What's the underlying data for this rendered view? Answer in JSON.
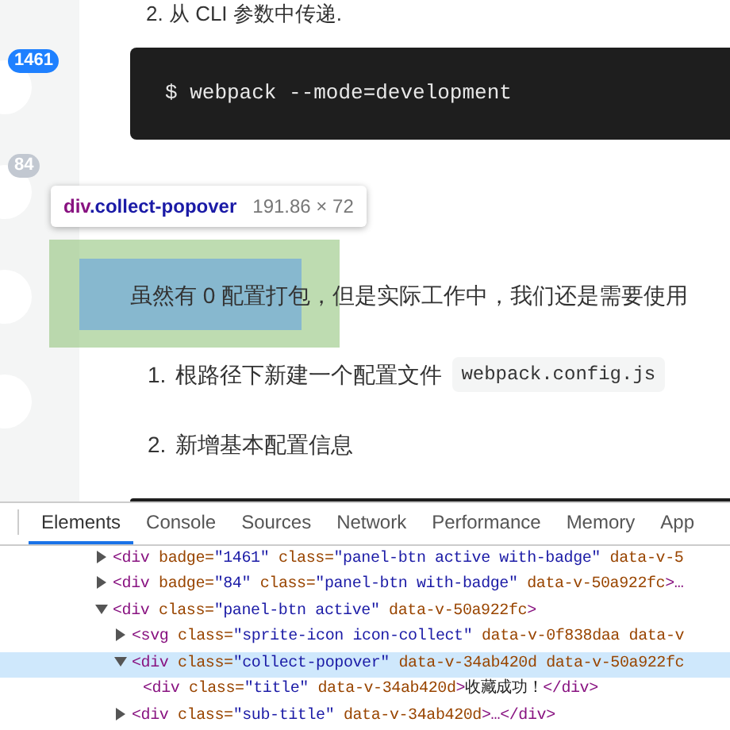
{
  "sidebar": {
    "badges": [
      {
        "text": "1461",
        "highlighted": true
      },
      {
        "text": "84",
        "highlighted": false
      }
    ]
  },
  "article": {
    "step_heading": "2.  从 CLI 参数中传递.",
    "command": "$ webpack --mode=development",
    "paragraph": "虽然有 0 配置打包，但是实际工作中，我们还是需要使用",
    "steps": [
      {
        "number": "1.",
        "text": "根路径下新建一个配置文件",
        "code": "webpack.config.js"
      },
      {
        "number": "2.",
        "text": "新增基本配置信息"
      }
    ]
  },
  "inspect_tooltip": {
    "tag": "div",
    "selector": ".collect-popover",
    "size": "191.86 × 72"
  },
  "devtools": {
    "tabs": [
      {
        "label": "Elements",
        "selected": true
      },
      {
        "label": "Console",
        "selected": false
      },
      {
        "label": "Sources",
        "selected": false
      },
      {
        "label": "Network",
        "selected": false
      },
      {
        "label": "Performance",
        "selected": false
      },
      {
        "label": "Memory",
        "selected": false
      },
      {
        "label": "App",
        "selected": false
      }
    ],
    "lines": [
      {
        "kind": "node",
        "expanded": false,
        "selected": false,
        "children": [
          {
            "kind": "tag",
            "text": "<div "
          },
          {
            "kind": "attr",
            "text": "badge="
          },
          {
            "kind": "value",
            "text": "\"1461\" "
          },
          {
            "kind": "attr",
            "text": "class="
          },
          {
            "kind": "value",
            "text": "\"panel-btn active with-badge\" "
          },
          {
            "kind": "attr",
            "text": "data-v-5"
          }
        ]
      },
      {
        "kind": "node",
        "expanded": false,
        "selected": false,
        "children": [
          {
            "kind": "tag",
            "text": "<div "
          },
          {
            "kind": "attr",
            "text": "badge="
          },
          {
            "kind": "value",
            "text": "\"84\" "
          },
          {
            "kind": "attr",
            "text": "class="
          },
          {
            "kind": "value",
            "text": "\"panel-btn with-badge\" "
          },
          {
            "kind": "attr",
            "text": "data-v-50a922fc"
          },
          {
            "kind": "tag",
            "text": ">…"
          }
        ]
      },
      {
        "kind": "node",
        "expanded": true,
        "selected": false,
        "children": [
          {
            "kind": "tag",
            "text": "<div "
          },
          {
            "kind": "attr",
            "text": "class="
          },
          {
            "kind": "value",
            "text": "\"panel-btn active\" "
          },
          {
            "kind": "attr",
            "text": "data-v-50a922fc"
          },
          {
            "kind": "tag",
            "text": ">"
          }
        ]
      },
      {
        "kind": "child",
        "expanded": false,
        "selected": false,
        "children": [
          {
            "kind": "tag",
            "text": "<svg "
          },
          {
            "kind": "attr",
            "text": "class="
          },
          {
            "kind": "value",
            "text": "\"sprite-icon icon-collect\" "
          },
          {
            "kind": "attr",
            "text": "data-v-0f838daa data-v"
          }
        ]
      },
      {
        "kind": "child",
        "expanded": true,
        "selected": true,
        "children": [
          {
            "kind": "tag",
            "text": "<div "
          },
          {
            "kind": "attr",
            "text": "class="
          },
          {
            "kind": "value",
            "text": "\"collect-popover\" "
          },
          {
            "kind": "attr",
            "text": "data-v-34ab420d data-v-50a922fc"
          }
        ]
      },
      {
        "kind": "leaf",
        "selected": false,
        "children": [
          {
            "kind": "tag",
            "text": "<div "
          },
          {
            "kind": "attr",
            "text": "class="
          },
          {
            "kind": "value",
            "text": "\"title\" "
          },
          {
            "kind": "attr",
            "text": "data-v-34ab420d"
          },
          {
            "kind": "tag",
            "text": ">"
          },
          {
            "kind": "text",
            "text": "收藏成功！"
          },
          {
            "kind": "tag",
            "text": "</div>"
          }
        ]
      },
      {
        "kind": "child",
        "expanded": false,
        "selected": false,
        "children": [
          {
            "kind": "tag",
            "text": "<div "
          },
          {
            "kind": "attr",
            "text": "class="
          },
          {
            "kind": "value",
            "text": "\"sub-title\" "
          },
          {
            "kind": "attr",
            "text": "data-v-34ab420d"
          },
          {
            "kind": "tag",
            "text": ">…</div>"
          }
        ]
      }
    ]
  }
}
